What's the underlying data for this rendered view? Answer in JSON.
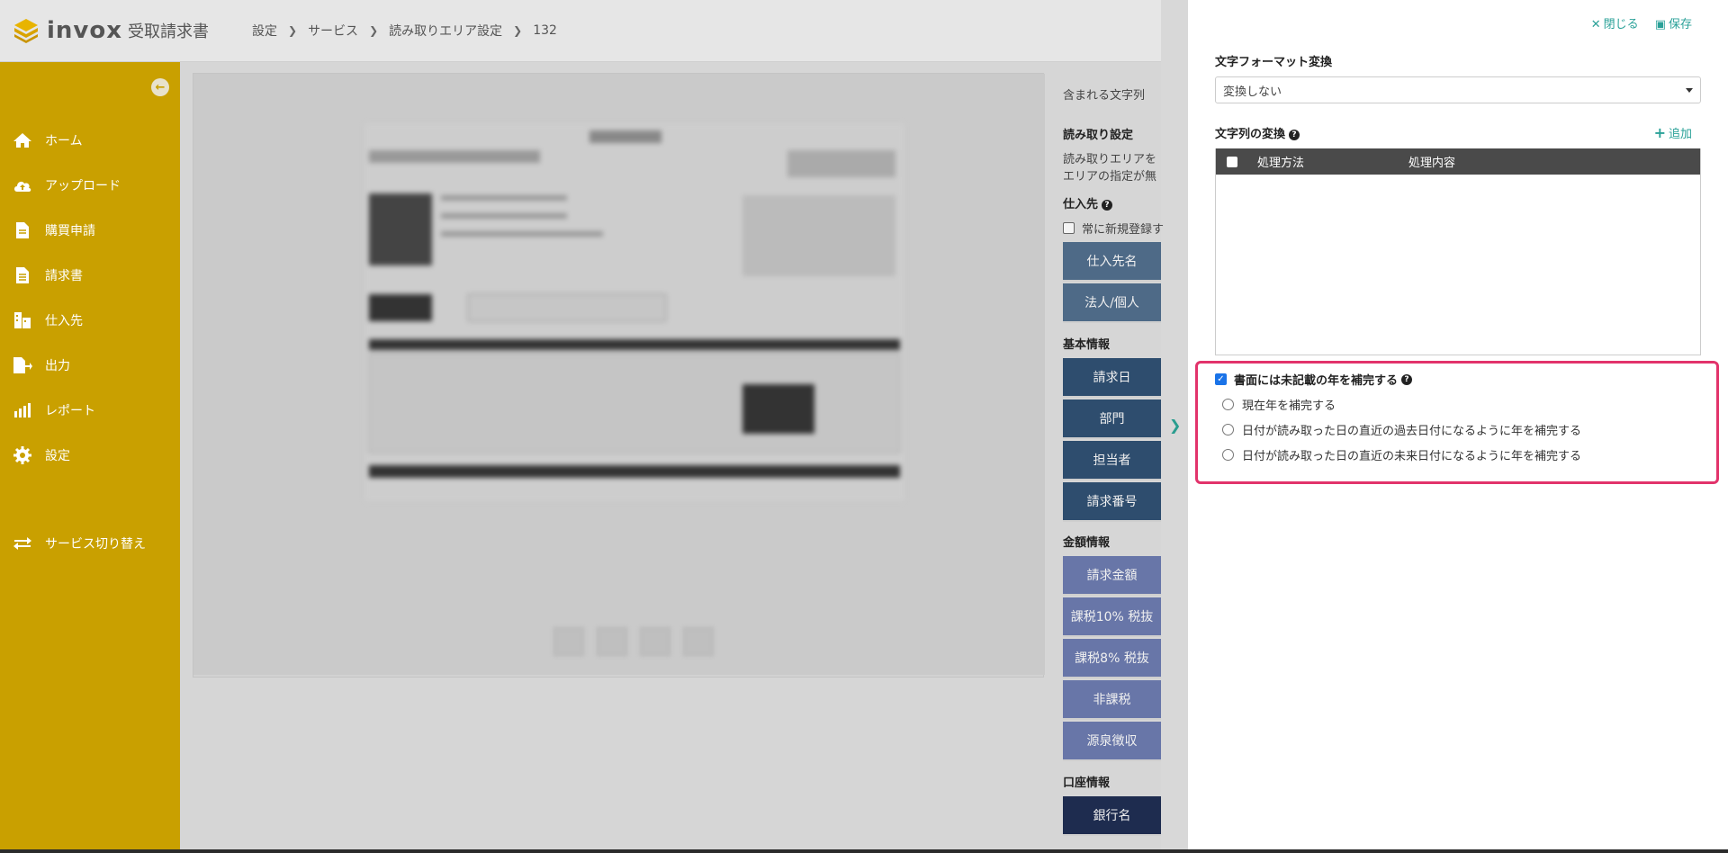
{
  "header": {
    "logo_text": "invox",
    "logo_sub": "受取請求書",
    "breadcrumb": [
      "設定",
      "サービス",
      "読み取りエリア設定",
      "132"
    ]
  },
  "sidebar": {
    "items": [
      {
        "label": "ホーム",
        "icon": "home-icon"
      },
      {
        "label": "アップロード",
        "icon": "cloud-upload-icon"
      },
      {
        "label": "購買申請",
        "icon": "document-icon"
      },
      {
        "label": "請求書",
        "icon": "invoice-icon"
      },
      {
        "label": "仕入先",
        "icon": "building-icon"
      },
      {
        "label": "出力",
        "icon": "export-icon"
      },
      {
        "label": "レポート",
        "icon": "chart-icon"
      },
      {
        "label": "設定",
        "icon": "gear-icon"
      }
    ],
    "switch_label": "サービス切り替え"
  },
  "fields": {
    "included_text": "含まれる文字列",
    "read_settings": "読み取り設定",
    "read_desc_1": "読み取りエリアを",
    "read_desc_2": "エリアの指定が無",
    "supplier_section": "仕入先",
    "always_register": "常に新規登録す",
    "supplier_buttons": [
      "仕入先名",
      "法人/個人"
    ],
    "basic_section": "基本情報",
    "basic_buttons": [
      "請求日",
      "部門",
      "担当者",
      "請求番号"
    ],
    "amount_section": "金額情報",
    "amount_buttons": [
      "請求金額",
      "課税10% 税抜",
      "課税8% 税抜",
      "非課税",
      "源泉徴収"
    ],
    "account_section": "口座情報",
    "account_buttons": [
      "銀行名"
    ]
  },
  "panel": {
    "close_label": "閉じる",
    "save_label": "保存",
    "format_title": "文字フォーマット変換",
    "format_value": "変換しない",
    "convert_title": "文字列の変換",
    "add_label": "追加",
    "table_headers": [
      "処理方法",
      "処理内容"
    ],
    "complement_label": "書面には未記載の年を補完する",
    "complement_checked": true,
    "radio_options": [
      "現在年を補完する",
      "日付が読み取った日の直近の過去日付になるように年を補完する",
      "日付が読み取った日の直近の未来日付になるように年を補完する"
    ]
  },
  "colors": {
    "sidebar": "#c9a000",
    "accent": "#2aa198",
    "highlight": "#e2336b"
  }
}
